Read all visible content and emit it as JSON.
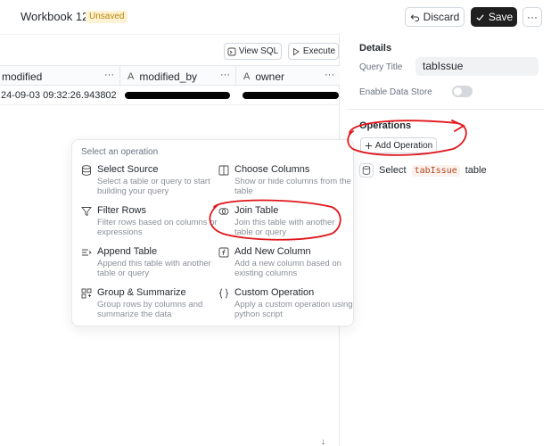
{
  "topbar": {
    "title": "Workbook 12",
    "badge": "Unsaved",
    "discard_label": "Discard",
    "save_label": "Save",
    "more_label": "···"
  },
  "toolbar": {
    "view_sql_label": "View SQL",
    "execute_label": "Execute"
  },
  "grid": {
    "columns": [
      {
        "type": "",
        "name": "modified"
      },
      {
        "type": "A",
        "name": "modified_by"
      },
      {
        "type": "A",
        "name": "owner"
      }
    ],
    "row1": {
      "modified": "24-09-03 09:32:26.943802"
    },
    "col_menu": "···"
  },
  "popup": {
    "title": "Select an operation",
    "operations": [
      {
        "name": "Select Source",
        "desc": "Select a table or query to start building your query",
        "icon": "database-icon"
      },
      {
        "name": "Choose Columns",
        "desc": "Show or hide columns from the table",
        "icon": "columns-icon"
      },
      {
        "name": "Filter Rows",
        "desc": "Filter rows based on columns or expressions",
        "icon": "filter-icon"
      },
      {
        "name": "Join Table",
        "desc": "Join this table with another table or query",
        "icon": "join-icon"
      },
      {
        "name": "Append Table",
        "desc": "Append this table with another table or query",
        "icon": "append-icon"
      },
      {
        "name": "Add New Column",
        "desc": "Add a new column based on existing columns",
        "icon": "function-icon"
      },
      {
        "name": "Group & Summarize",
        "desc": "Group rows by columns and summarize the data",
        "icon": "group-icon"
      },
      {
        "name": "Custom Operation",
        "desc": "Apply a custom operation using python script",
        "icon": "braces-icon"
      }
    ]
  },
  "details": {
    "heading": "Details",
    "query_title_label": "Query Title",
    "query_title_value": "tabIssue",
    "enable_data_store_label": "Enable Data Store",
    "enable_data_store_on": false
  },
  "operations_panel": {
    "heading": "Operations",
    "add_label": "Add Operation",
    "step": {
      "prefix": "Select",
      "table": "tabIssue",
      "suffix": "table"
    }
  },
  "colors": {
    "annotation": "#e0161b",
    "badge_bg": "#fdf3d4",
    "badge_text": "#b8860b",
    "save_bg": "#1f1f1f"
  }
}
